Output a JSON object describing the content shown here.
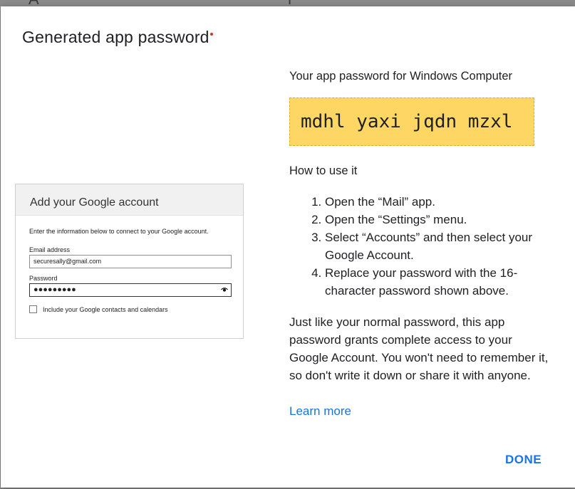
{
  "dialog": {
    "title": "Generated app password",
    "done_label": "DONE"
  },
  "mockup": {
    "title": "Add your Google account",
    "intro": "Enter the information below to connect to your Google account.",
    "email_label": "Email address",
    "email_value": "securesally@gmail.com",
    "password_label": "Password",
    "password_mask": "●●●●●●●●●",
    "checkbox_label": "Include your Google contacts and calendars",
    "eye_icon": "eye-icon"
  },
  "info": {
    "for_line": "Your app password for Windows Computer",
    "app_password": "mdhl yaxi jqdn mzxl",
    "howto_heading": "How to use it",
    "steps": [
      "Open the “Mail” app.",
      "Open the “Settings” menu.",
      "Select “Accounts” and then select your Google Account.",
      "Replace your password with the 16-character password shown above."
    ],
    "note": "Just like your normal password, this app password grants complete access to your Google Account. You won't need to remember it, so don't write it down or share it with anyone.",
    "learn_more": "Learn more"
  },
  "colors": {
    "accent": "#1a73e8",
    "password_bg": "#fdd663"
  }
}
